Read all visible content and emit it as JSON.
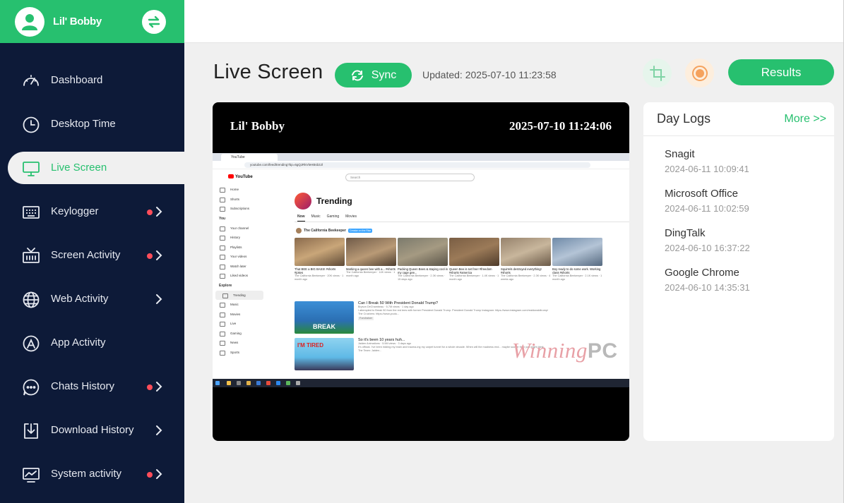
{
  "profile": {
    "name": "Lil' Bobby"
  },
  "nav": [
    {
      "key": "dashboard",
      "label": "Dashboard",
      "icon": "gauge-icon",
      "dot": false,
      "chevron": false
    },
    {
      "key": "desktop-time",
      "label": "Desktop Time",
      "icon": "clock-icon",
      "dot": false,
      "chevron": false
    },
    {
      "key": "live-screen",
      "label": "Live Screen",
      "icon": "monitor-icon",
      "dot": false,
      "chevron": false,
      "active": true
    },
    {
      "key": "keylogger",
      "label": "Keylogger",
      "icon": "keyboard-icon",
      "dot": true,
      "chevron": true
    },
    {
      "key": "screen-activity",
      "label": "Screen Activity",
      "icon": "tv-icon",
      "dot": true,
      "chevron": true
    },
    {
      "key": "web-activity",
      "label": "Web Activity",
      "icon": "globe-icon",
      "dot": false,
      "chevron": true
    },
    {
      "key": "app-activity",
      "label": "App Activity",
      "icon": "app-store-icon",
      "dot": false,
      "chevron": false
    },
    {
      "key": "chats-history",
      "label": "Chats History",
      "icon": "chat-bubble-icon",
      "dot": true,
      "chevron": true
    },
    {
      "key": "download-history",
      "label": "Download History",
      "icon": "download-icon",
      "dot": false,
      "chevron": true
    },
    {
      "key": "system-activity",
      "label": "System activity",
      "icon": "chart-monitor-icon",
      "dot": true,
      "chevron": true
    }
  ],
  "header": {
    "title": "Live Screen",
    "sync_label": "Sync",
    "updated": "Updated: 2025-07-10 11:23:58",
    "results_label": "Results"
  },
  "screen": {
    "name": "Lil' Bobby",
    "time": "2025-07-10 11:24:06",
    "browser_tab": "YouTube",
    "url": "youtube.com/feed/trending?bp=6gQJRkVleHBsb3Jl",
    "search_placeholder": "Search",
    "yt_logo": "YouTube",
    "yt_sidebar": {
      "top": [
        "Home",
        "Shorts",
        "Subscriptions"
      ],
      "you_heading": "You",
      "you": [
        "Your channel",
        "History",
        "Playlists",
        "Your videos",
        "Watch later",
        "Liked videos"
      ],
      "explore_heading": "Explore",
      "explore": [
        "Trending",
        "Music",
        "Movies",
        "Live",
        "Gaming",
        "News",
        "Sports"
      ]
    },
    "trending_title": "Trending",
    "trending_tabs": [
      "Now",
      "Music",
      "Gaming",
      "Movies"
    ],
    "channel": "The California Beekeeper",
    "channel_badge": "Creator on the Rise",
    "shorts": [
      {
        "title": "That BEE a BIG BASS! #shorts #jokes",
        "meta": "The California Beekeeper · 20K views · 1 month ago"
      },
      {
        "title": "Marking a queen bee with a... #shorts",
        "meta": "The California Beekeeper · 14K views · 1 month ago"
      },
      {
        "title": "Packing Queen Bees & staying cool in my cage gee...",
        "meta": "The California Beekeeper · 2.3K views · 15 days ago"
      },
      {
        "title": "Queen Bee is set free! #freedom #shorts #america",
        "meta": "The California Beekeeper · 1.4K views · 1 month ago"
      },
      {
        "title": "Squirrels destroyed everything! #shorts",
        "meta": "The California Beekeeper · 2.3K views · 4 weeks ago"
      },
      {
        "title": "Boy ready to do some work. Working class #shorts",
        "meta": "The California Beekeeper · 2.1K views · 1 month ago"
      }
    ],
    "videos": [
      {
        "title": "Can I Break 50 With President Donald Trump?",
        "meta": "Bryson DeChambeau · 5.7M views · 1 day ago",
        "desc": "I attempted to Break 50 from the red tees with former President Donald Trump. President Donald Trump Instagram: https://www.instagram.com/realdonaldtrump/ The Crushers: https://www.youtu...",
        "tag": "Fundraiser",
        "thumb_text": "BREAK"
      },
      {
        "title": "So it's been 10 years huh...",
        "meta": "Jaiden Animations · 5.5M views · 3 days ago",
        "desc": "It's official. I've been ridding my brain and trauma-ing my carpet tunnel for a whole decade. When will the madness end... maybe sooner than you might think. The Team: Jaiden...",
        "tag": "",
        "thumb_text": "I'M TIRED"
      }
    ],
    "watermark_a": "Winning",
    "watermark_b": "PC"
  },
  "logs": {
    "title": "Day Logs",
    "more": "More >>",
    "items": [
      {
        "name": "Snagit",
        "time": "2024-06-11 10:09:41"
      },
      {
        "name": "Microsoft Office",
        "time": "2024-06-11 10:02:59"
      },
      {
        "name": "DingTalk",
        "time": "2024-06-10 16:37:22"
      },
      {
        "name": "Google Chrome",
        "time": "2024-06-10 14:35:31"
      }
    ]
  },
  "colors": {
    "accent": "#27c06f",
    "sidebar": "#0d1a38",
    "dot": "#ff4d5a"
  }
}
